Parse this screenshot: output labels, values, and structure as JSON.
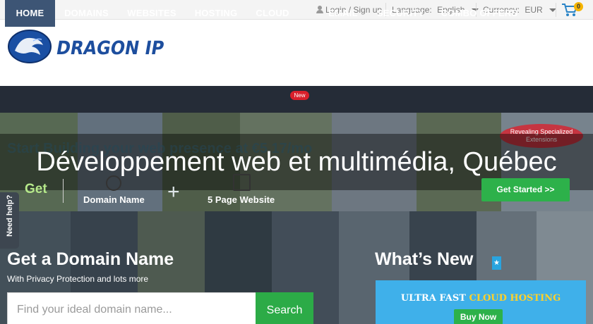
{
  "topbar": {
    "login": "Login / Sign up",
    "language_label": "Language:",
    "language_value": "English",
    "currency_label": "Currency:",
    "currency_value": "EUR",
    "cart_count": "0"
  },
  "logo": {
    "text": "DRAGON IP"
  },
  "nav": {
    "items": [
      {
        "label": "HOME"
      },
      {
        "label": "DOMAINS"
      },
      {
        "label": "WEBSITES"
      },
      {
        "label": "HOSTING"
      },
      {
        "label": "CLOUD"
      },
      {
        "label": "EMAIL"
      },
      {
        "label": "SECURITY"
      },
      {
        "label": "COMBO OFFERS"
      }
    ],
    "new_badge": "New",
    "active": "HOME"
  },
  "hero": {
    "faded_promo": "Start Building your web presence at €5.17/mo",
    "overlay_title": "Développement web et multimédia, Québec",
    "get": "Get",
    "feature_1": "Domain Name",
    "feature_2": "5 Page Website",
    "plus": "+",
    "get_started": "Get Started >>",
    "ribbon": "Revealing Specialized Extensions"
  },
  "domain": {
    "title": "Get a Domain Name",
    "subtitle": "With Privacy Protection and lots more",
    "search_placeholder": "Find your ideal domain name...",
    "search_button": "Search"
  },
  "whats_new": {
    "title": "What’s New",
    "promo_prefix": "ULTRA FAST ",
    "promo_highlight": "CLOUD HOSTING",
    "buy_now": "Buy Now"
  },
  "help_tab": {
    "label": "Need help?"
  },
  "colors": {
    "nav_bg": "#252c37",
    "nav_active": "#3d5575",
    "green_button": "#2db14a",
    "brand_blue": "#1d4e9e",
    "promo_blue": "#3fb0ea",
    "badge_red": "#d9202b"
  },
  "icons": [
    "user-icon",
    "caret-down-icon",
    "cart-icon",
    "globe-icon",
    "document-icon",
    "star-icon",
    "dragon-logo-icon"
  ]
}
